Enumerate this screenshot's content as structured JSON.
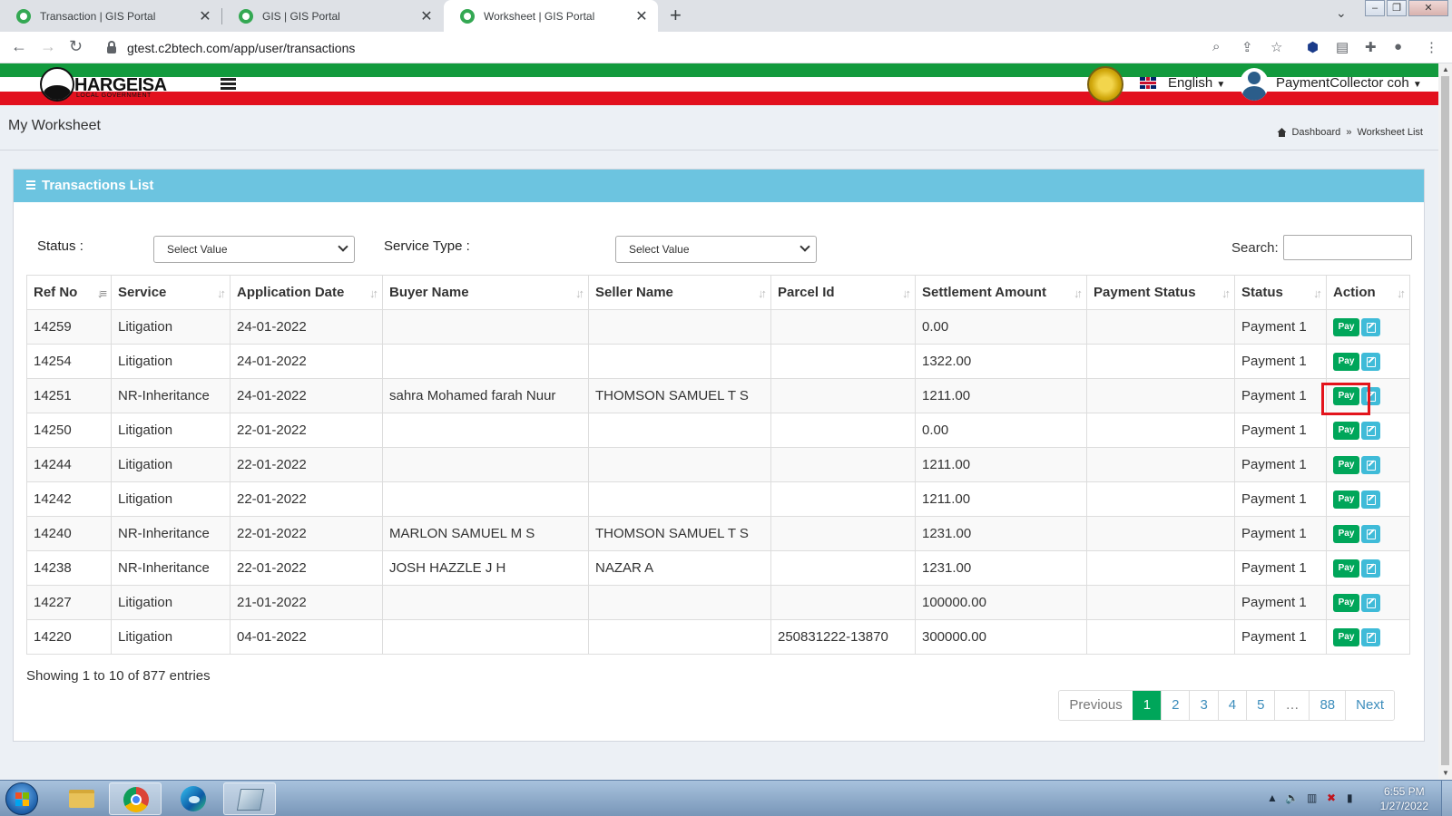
{
  "browser": {
    "tabs": [
      {
        "label": "Transaction | GIS Portal",
        "active": false
      },
      {
        "label": "GIS | GIS Portal",
        "active": false
      },
      {
        "label": "Worksheet | GIS Portal",
        "active": true
      }
    ],
    "new_tab": "+",
    "close_glyph": "✕",
    "url": "gtest.c2btech.com/app/user/transactions"
  },
  "header": {
    "logo_text": "HARGEISA",
    "logo_subtext": "LOCAL GOVERNMENT",
    "language": "English",
    "user_name": "PaymentCollector coh",
    "colors": {
      "green": "#129a3d",
      "white": "#ffffff",
      "red": "#e2101e"
    }
  },
  "page": {
    "title": "My Worksheet",
    "breadcrumb": {
      "home": "Dashboard",
      "separator": "»",
      "current": "Worksheet List"
    }
  },
  "box": {
    "title": "Transactions List",
    "header_color": "#6cc4e0"
  },
  "filters": {
    "status_label": "Status :",
    "status_value": "Select Value",
    "service_type_label": "Service Type :",
    "service_type_value": "Select Value",
    "search_label": "Search:",
    "search_value": ""
  },
  "table": {
    "columns": [
      "Ref No",
      "Service",
      "Application Date",
      "Buyer Name",
      "Seller Name",
      "Parcel Id",
      "Settlement Amount",
      "Payment Status",
      "Status",
      "Action"
    ],
    "pay_label": "Pay",
    "rows": [
      {
        "ref": "14259",
        "service": "Litigation",
        "date": "24-01-2022",
        "buyer": "",
        "seller": "",
        "parcel": "",
        "amount": "0.00",
        "payment_status": "",
        "status": "Payment 1"
      },
      {
        "ref": "14254",
        "service": "Litigation",
        "date": "24-01-2022",
        "buyer": "",
        "seller": "",
        "parcel": "",
        "amount": "1322.00",
        "payment_status": "",
        "status": "Payment 1"
      },
      {
        "ref": "14251",
        "service": "NR-Inheritance",
        "date": "24-01-2022",
        "buyer": "sahra Mohamed farah Nuur",
        "seller": "THOMSON SAMUEL T S",
        "parcel": "",
        "amount": "1211.00",
        "payment_status": "",
        "status": "Payment 1"
      },
      {
        "ref": "14250",
        "service": "Litigation",
        "date": "22-01-2022",
        "buyer": "",
        "seller": "",
        "parcel": "",
        "amount": "0.00",
        "payment_status": "",
        "status": "Payment 1"
      },
      {
        "ref": "14244",
        "service": "Litigation",
        "date": "22-01-2022",
        "buyer": "",
        "seller": "",
        "parcel": "",
        "amount": "1211.00",
        "payment_status": "",
        "status": "Payment 1"
      },
      {
        "ref": "14242",
        "service": "Litigation",
        "date": "22-01-2022",
        "buyer": "",
        "seller": "",
        "parcel": "",
        "amount": "1211.00",
        "payment_status": "",
        "status": "Payment 1"
      },
      {
        "ref": "14240",
        "service": "NR-Inheritance",
        "date": "22-01-2022",
        "buyer": "MARLON SAMUEL M S",
        "seller": "THOMSON SAMUEL T S",
        "parcel": "",
        "amount": "1231.00",
        "payment_status": "",
        "status": "Payment 1"
      },
      {
        "ref": "14238",
        "service": "NR-Inheritance",
        "date": "22-01-2022",
        "buyer": "JOSH HAZZLE J H",
        "seller": "NAZAR A",
        "parcel": "",
        "amount": "1231.00",
        "payment_status": "",
        "status": "Payment 1"
      },
      {
        "ref": "14227",
        "service": "Litigation",
        "date": "21-01-2022",
        "buyer": "",
        "seller": "",
        "parcel": "",
        "amount": "100000.00",
        "payment_status": "",
        "status": "Payment 1"
      },
      {
        "ref": "14220",
        "service": "Litigation",
        "date": "04-01-2022",
        "buyer": "",
        "seller": "",
        "parcel": "250831222-13870",
        "amount": "300000.00",
        "payment_status": "",
        "status": "Payment 1"
      }
    ]
  },
  "footer": {
    "showing": "Showing 1 to 10 of 877 entries",
    "pager": [
      "Previous",
      "1",
      "2",
      "3",
      "4",
      "5",
      "…",
      "88",
      "Next"
    ],
    "active_page": "1"
  },
  "taskbar": {
    "time": "6:55 PM",
    "date": "1/27/2022"
  }
}
